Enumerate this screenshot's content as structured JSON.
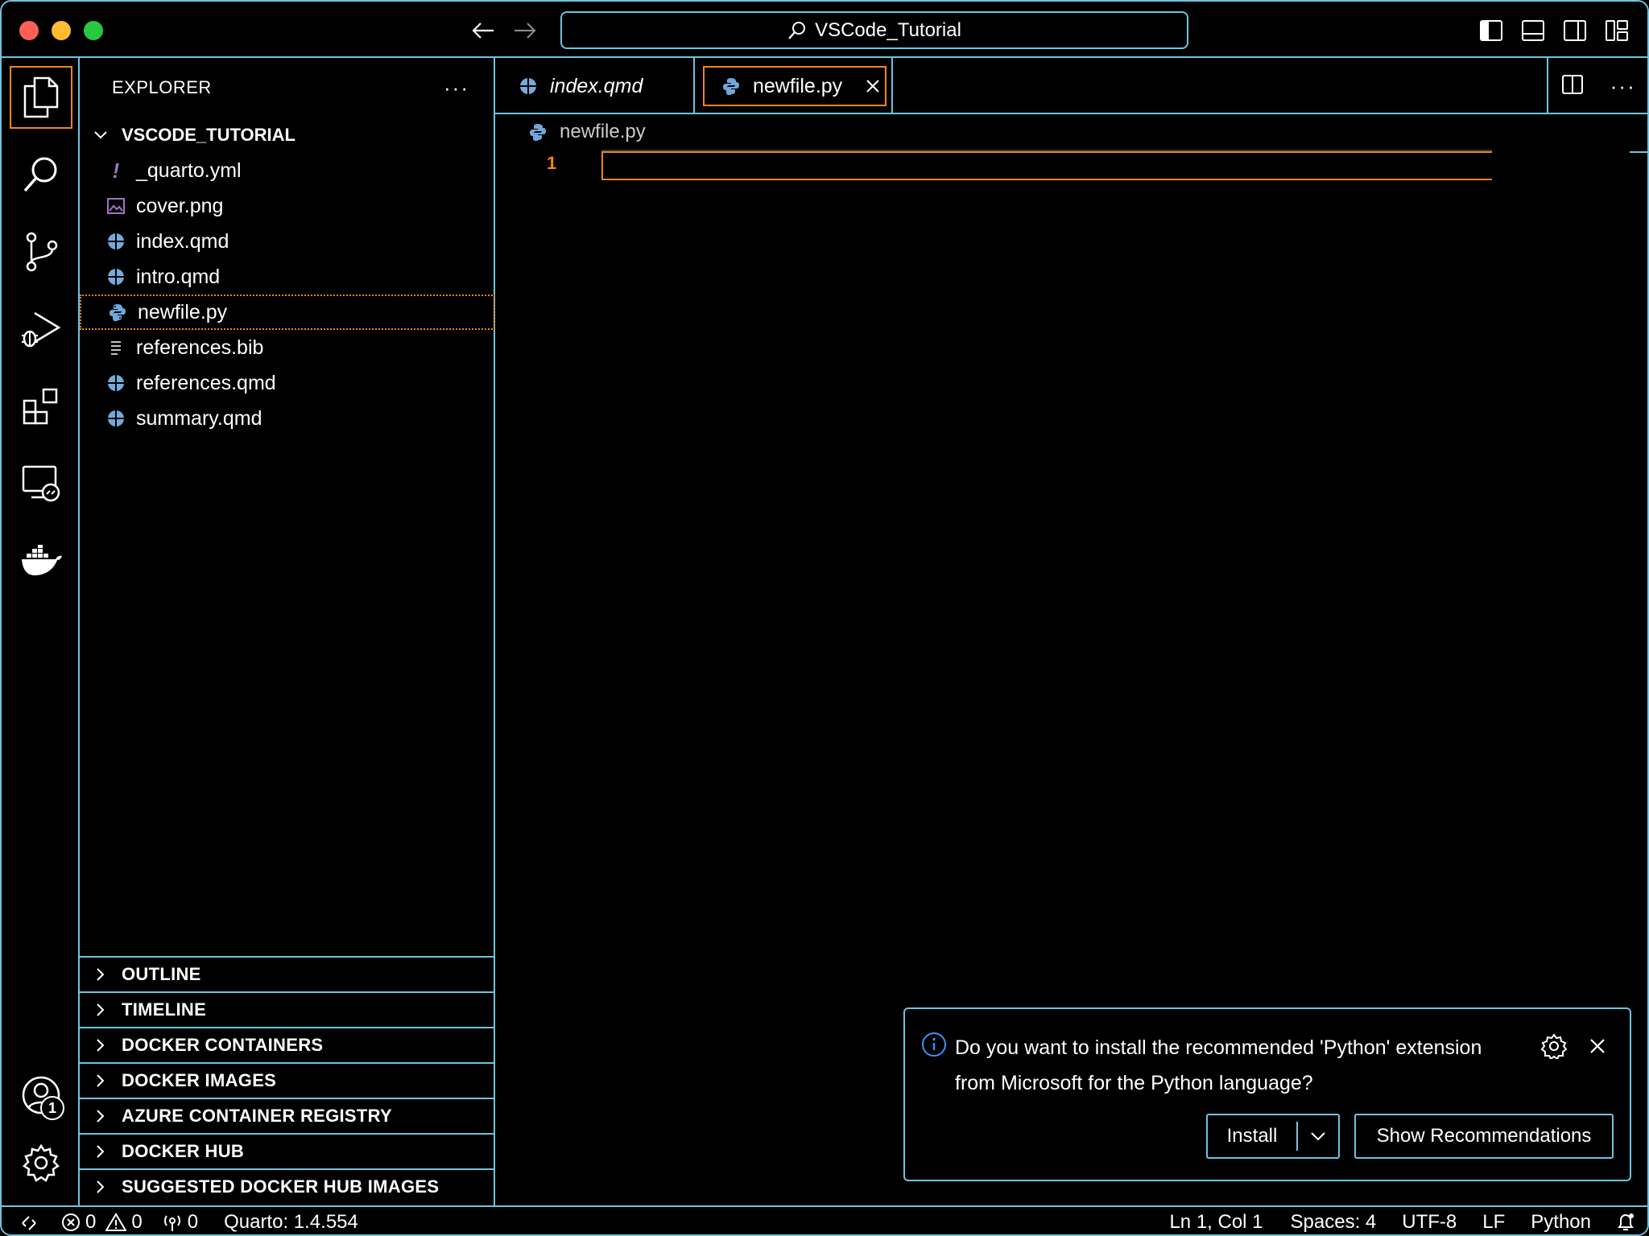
{
  "titlebar": {
    "search_label": "VSCode_Tutorial"
  },
  "activitybar": {
    "items": [
      {
        "name": "explorer",
        "icon": "files-icon"
      },
      {
        "name": "search",
        "icon": "search-icon"
      },
      {
        "name": "source-control",
        "icon": "source-control-icon"
      },
      {
        "name": "run-debug",
        "icon": "run-debug-icon"
      },
      {
        "name": "extensions",
        "icon": "extensions-icon"
      },
      {
        "name": "remote-explorer",
        "icon": "remote-explorer-icon"
      },
      {
        "name": "docker",
        "icon": "docker-icon"
      }
    ],
    "accounts_badge": "1"
  },
  "sidebar": {
    "title": "EXPLORER",
    "folder": "VSCODE_TUTORIAL",
    "files": [
      {
        "label": "_quarto.yml",
        "icon": "yaml-icon"
      },
      {
        "label": "cover.png",
        "icon": "image-icon"
      },
      {
        "label": "index.qmd",
        "icon": "quarto-icon"
      },
      {
        "label": "intro.qmd",
        "icon": "quarto-icon"
      },
      {
        "label": "newfile.py",
        "icon": "python-icon"
      },
      {
        "label": "references.bib",
        "icon": "text-lines-icon"
      },
      {
        "label": "references.qmd",
        "icon": "quarto-icon"
      },
      {
        "label": "summary.qmd",
        "icon": "quarto-icon"
      }
    ],
    "panels": [
      "OUTLINE",
      "TIMELINE",
      "DOCKER CONTAINERS",
      "DOCKER IMAGES",
      "AZURE CONTAINER REGISTRY",
      "DOCKER HUB",
      "SUGGESTED DOCKER HUB IMAGES"
    ]
  },
  "editor": {
    "tabs": [
      {
        "label": "index.qmd"
      },
      {
        "label": "newfile.py"
      }
    ],
    "breadcrumb": "newfile.py",
    "line_number": "1"
  },
  "notification": {
    "message": "Do you want to install the recommended 'Python' extension from Microsoft for the Python language?",
    "install_label": "Install",
    "show_label": "Show Recommendations"
  },
  "statusbar": {
    "errors": "0",
    "warnings": "0",
    "ports": "0",
    "quarto": "Quarto: 1.4.554",
    "position": "Ln 1, Col 1",
    "spaces": "Spaces: 4",
    "encoding": "UTF-8",
    "eol": "LF",
    "language": "Python"
  },
  "colors": {
    "border": "#6fc3df",
    "focus": "#f38518",
    "quarto_icon": "#74aadb",
    "python_icon": "#6fa8dc",
    "yaml_icon": "#a074c4"
  }
}
